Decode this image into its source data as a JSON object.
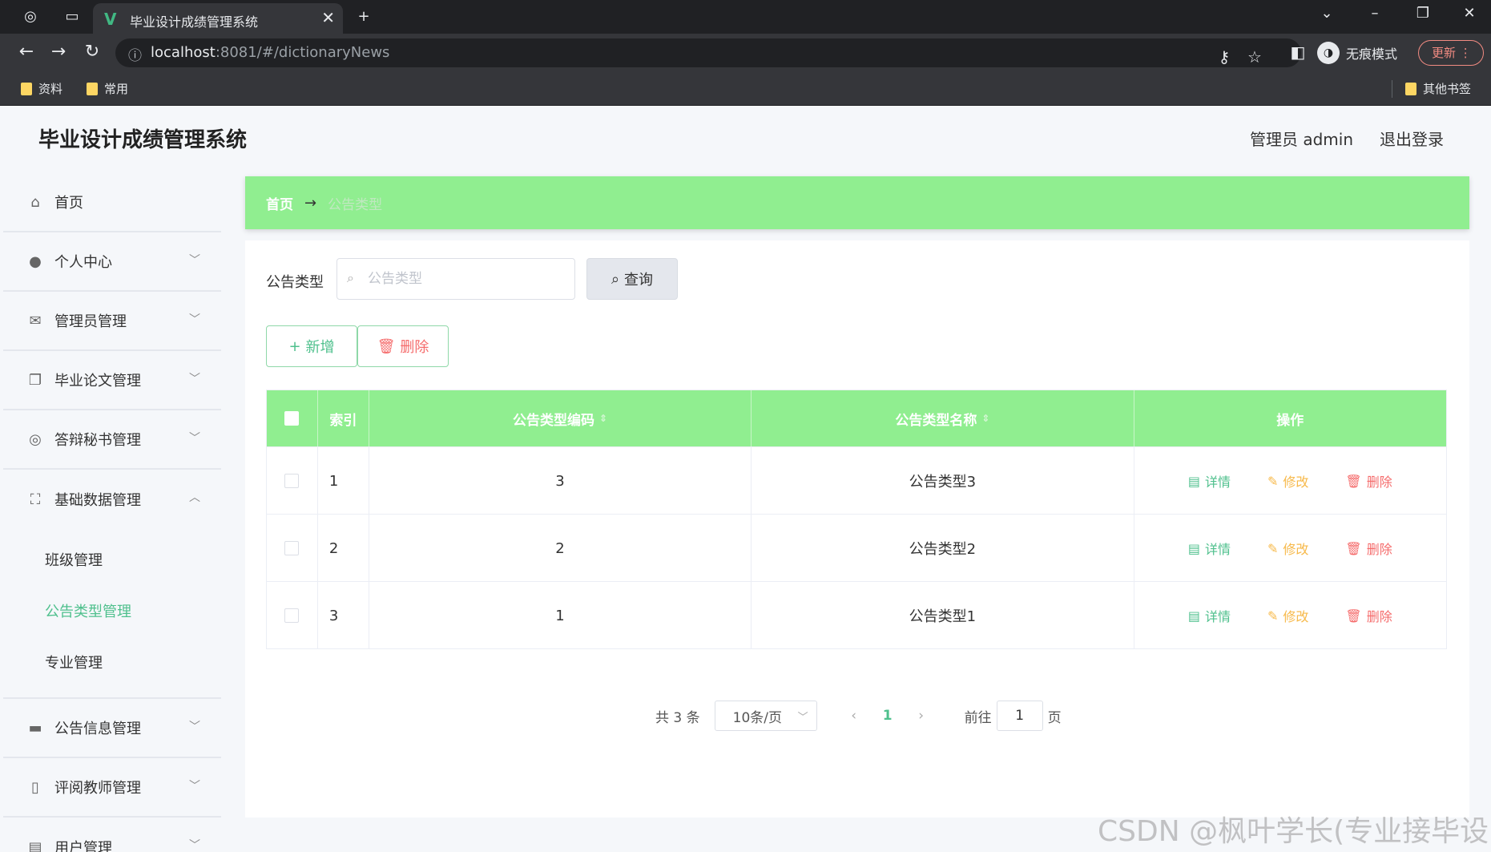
{
  "browser": {
    "tab_title": "毕业设计成绩管理系统",
    "url_host": "localhost",
    "url_rest": ":8081/#/dictionaryNews",
    "incognito_label": "无痕模式",
    "update_label": "更新",
    "bookmarks": [
      "资料",
      "常用"
    ],
    "other_bookmarks": "其他书签"
  },
  "header": {
    "app_title": "毕业设计成绩管理系统",
    "user_info": "管理员 admin",
    "logout": "退出登录"
  },
  "sidebar": {
    "home": "首页",
    "items": [
      {
        "label": "个人中心",
        "icon": "user-icon"
      },
      {
        "label": "管理员管理",
        "icon": "mail-icon"
      },
      {
        "label": "毕业论文管理",
        "icon": "copy-icon"
      },
      {
        "label": "答辩秘书管理",
        "icon": "target-icon"
      },
      {
        "label": "基础数据管理",
        "icon": "fullscreen-icon"
      }
    ],
    "subitems": [
      "班级管理",
      "公告类型管理",
      "专业管理"
    ],
    "active_subitem": "公告类型管理",
    "items_after": [
      {
        "label": "公告信息管理",
        "icon": "monitor-icon"
      },
      {
        "label": "评阅教师管理",
        "icon": "microphone-icon"
      },
      {
        "label": "用户管理",
        "icon": "clipboard-icon"
      }
    ]
  },
  "breadcrumb": {
    "home": "首页",
    "arrow": "→",
    "current": "公告类型"
  },
  "search": {
    "label": "公告类型",
    "placeholder": "公告类型",
    "query_button": "查询"
  },
  "actions": {
    "add": "新增",
    "delete": "删除"
  },
  "table": {
    "columns": [
      "索引",
      "公告类型编码",
      "公告类型名称",
      "操作"
    ],
    "rows": [
      {
        "index": "1",
        "code": "3",
        "name": "公告类型3"
      },
      {
        "index": "2",
        "code": "2",
        "name": "公告类型2"
      },
      {
        "index": "3",
        "code": "1",
        "name": "公告类型1"
      }
    ],
    "ops": {
      "detail": "详情",
      "edit": "修改",
      "remove": "删除"
    }
  },
  "pagination": {
    "total": "共 3 条",
    "page_size": "10条/页",
    "current_page": "1",
    "goto_label": "前往",
    "goto_value": "1",
    "page_suffix": "页"
  },
  "watermark": "CSDN @枫叶学长(专业接毕设)",
  "colors": {
    "accent_green": "#90ee90",
    "active_text": "#4fc08d",
    "edit": "#f7b94a",
    "danger": "#f56c6c"
  }
}
